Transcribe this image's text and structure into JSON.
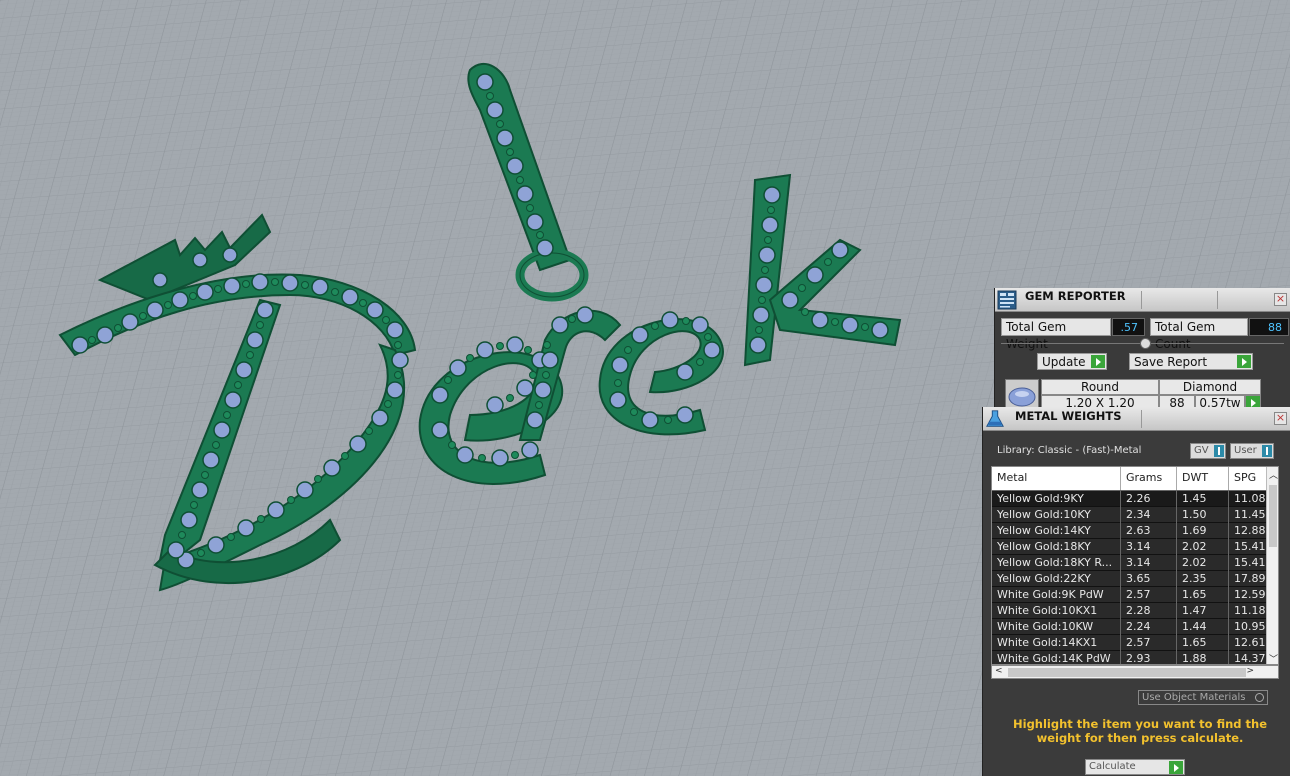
{
  "gem_reporter": {
    "title": "GEM REPORTER",
    "total_gem_weight_label": "Total Gem Weight",
    "total_gem_weight_value": ".57",
    "total_gem_count_label": "Total Gem Count",
    "total_gem_count_value": "88",
    "update_label": "Update",
    "save_report_label": "Save Report",
    "gem": {
      "shape": "Round",
      "material": "Diamond",
      "size": "1.20 X 1.20",
      "count": "88",
      "weight": "0.57tw"
    }
  },
  "metal_weights": {
    "title": "METAL WEIGHTS",
    "library_label": "Library: Classic - (Fast)-Metal",
    "dropdown_gv": "GV",
    "dropdown_user": "User",
    "columns": [
      "Metal",
      "Grams",
      "DWT",
      "SPG"
    ],
    "rows": [
      {
        "metal": "Yellow Gold:9KY",
        "grams": "2.26",
        "dwt": "1.45",
        "spg": "11.08"
      },
      {
        "metal": "Yellow Gold:10KY",
        "grams": "2.34",
        "dwt": "1.50",
        "spg": "11.45"
      },
      {
        "metal": "Yellow Gold:14KY",
        "grams": "2.63",
        "dwt": "1.69",
        "spg": "12.88"
      },
      {
        "metal": "Yellow Gold:18KY",
        "grams": "3.14",
        "dwt": "2.02",
        "spg": "15.41"
      },
      {
        "metal": "Yellow Gold:18KY R...",
        "grams": "3.14",
        "dwt": "2.02",
        "spg": "15.41"
      },
      {
        "metal": "Yellow Gold:22KY",
        "grams": "3.65",
        "dwt": "2.35",
        "spg": "17.89"
      },
      {
        "metal": "White Gold:9K PdW",
        "grams": "2.57",
        "dwt": "1.65",
        "spg": "12.59"
      },
      {
        "metal": "White Gold:10KX1",
        "grams": "2.28",
        "dwt": "1.47",
        "spg": "11.18"
      },
      {
        "metal": "White Gold:10KW",
        "grams": "2.24",
        "dwt": "1.44",
        "spg": "10.95"
      },
      {
        "metal": "White Gold:14KX1",
        "grams": "2.57",
        "dwt": "1.65",
        "spg": "12.61"
      },
      {
        "metal": "White Gold:14K PdW",
        "grams": "2.93",
        "dwt": "1.88",
        "spg": "14.37"
      }
    ],
    "use_object_materials_label": "Use Object Materials",
    "hint": "Highlight the item you want to find the weight for then press calculate.",
    "calculate_label": "Calculate"
  }
}
